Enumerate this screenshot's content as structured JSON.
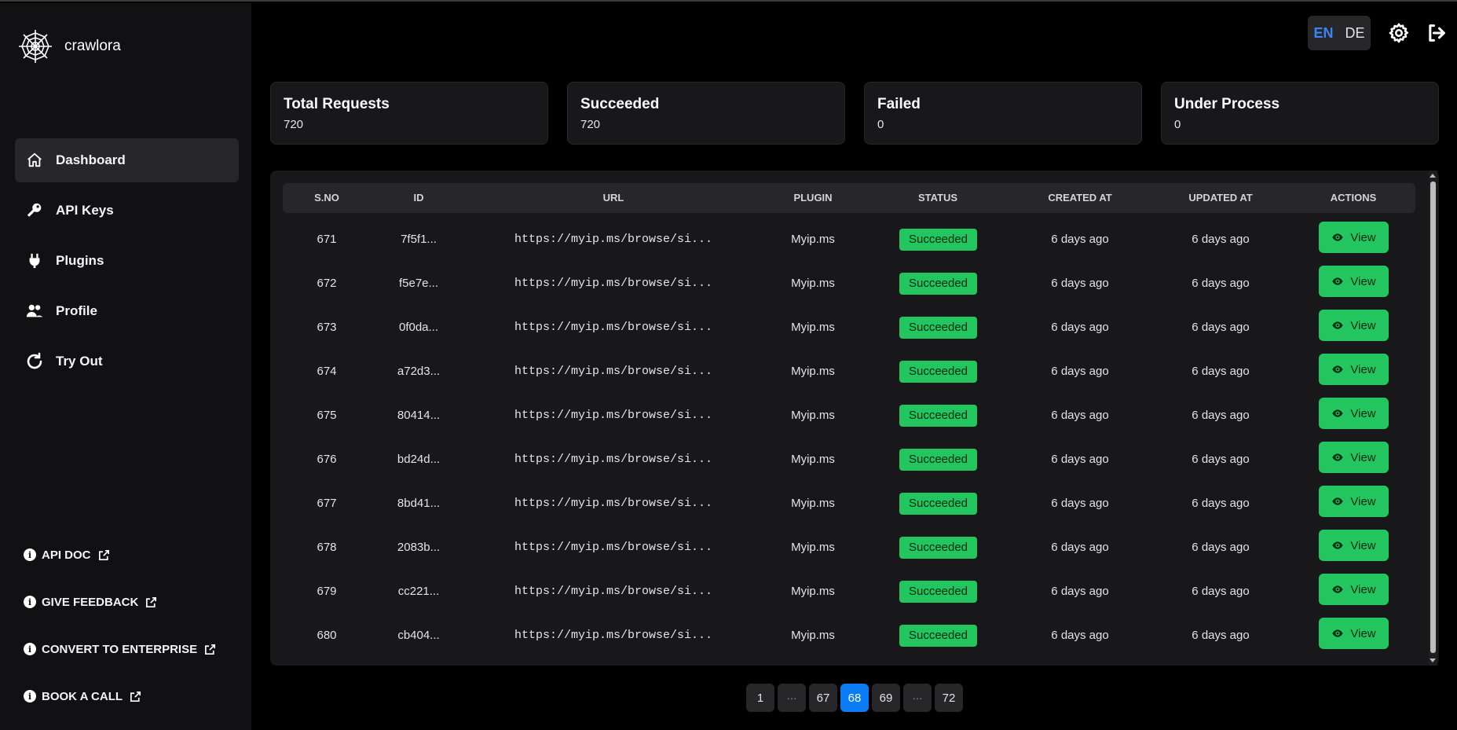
{
  "app": {
    "name": "crawlora"
  },
  "sidebar": {
    "items": [
      {
        "label": "Dashboard",
        "icon": "home-icon"
      },
      {
        "label": "API Keys",
        "icon": "key-icon"
      },
      {
        "label": "Plugins",
        "icon": "plug-icon"
      },
      {
        "label": "Profile",
        "icon": "users-icon"
      },
      {
        "label": "Try Out",
        "icon": "refresh-icon"
      }
    ],
    "active": "Dashboard",
    "links": [
      {
        "label": "API DOC"
      },
      {
        "label": "GIVE FEEDBACK"
      },
      {
        "label": "CONVERT TO ENTERPRISE"
      },
      {
        "label": "BOOK A CALL"
      }
    ]
  },
  "topbar": {
    "lang_en": "EN",
    "lang_de": "DE",
    "active_lang": "EN"
  },
  "stats": [
    {
      "title": "Total Requests",
      "value": "720"
    },
    {
      "title": "Succeeded",
      "value": "720"
    },
    {
      "title": "Failed",
      "value": "0"
    },
    {
      "title": "Under Process",
      "value": "0"
    }
  ],
  "table": {
    "headers": [
      "S.NO",
      "ID",
      "URL",
      "PLUGIN",
      "STATUS",
      "CREATED AT",
      "UPDATED AT",
      "ACTIONS"
    ],
    "rows": [
      {
        "sno": "671",
        "id": "7f5f1...",
        "url": "https://myip.ms/browse/si...",
        "plugin": "Myip.ms",
        "status": "Succeeded",
        "created": "6 days ago",
        "updated": "6 days ago",
        "action": "View"
      },
      {
        "sno": "672",
        "id": "f5e7e...",
        "url": "https://myip.ms/browse/si...",
        "plugin": "Myip.ms",
        "status": "Succeeded",
        "created": "6 days ago",
        "updated": "6 days ago",
        "action": "View"
      },
      {
        "sno": "673",
        "id": "0f0da...",
        "url": "https://myip.ms/browse/si...",
        "plugin": "Myip.ms",
        "status": "Succeeded",
        "created": "6 days ago",
        "updated": "6 days ago",
        "action": "View"
      },
      {
        "sno": "674",
        "id": "a72d3...",
        "url": "https://myip.ms/browse/si...",
        "plugin": "Myip.ms",
        "status": "Succeeded",
        "created": "6 days ago",
        "updated": "6 days ago",
        "action": "View"
      },
      {
        "sno": "675",
        "id": "80414...",
        "url": "https://myip.ms/browse/si...",
        "plugin": "Myip.ms",
        "status": "Succeeded",
        "created": "6 days ago",
        "updated": "6 days ago",
        "action": "View"
      },
      {
        "sno": "676",
        "id": "bd24d...",
        "url": "https://myip.ms/browse/si...",
        "plugin": "Myip.ms",
        "status": "Succeeded",
        "created": "6 days ago",
        "updated": "6 days ago",
        "action": "View"
      },
      {
        "sno": "677",
        "id": "8bd41...",
        "url": "https://myip.ms/browse/si...",
        "plugin": "Myip.ms",
        "status": "Succeeded",
        "created": "6 days ago",
        "updated": "6 days ago",
        "action": "View"
      },
      {
        "sno": "678",
        "id": "2083b...",
        "url": "https://myip.ms/browse/si...",
        "plugin": "Myip.ms",
        "status": "Succeeded",
        "created": "6 days ago",
        "updated": "6 days ago",
        "action": "View"
      },
      {
        "sno": "679",
        "id": "cc221...",
        "url": "https://myip.ms/browse/si...",
        "plugin": "Myip.ms",
        "status": "Succeeded",
        "created": "6 days ago",
        "updated": "6 days ago",
        "action": "View"
      },
      {
        "sno": "680",
        "id": "cb404...",
        "url": "https://myip.ms/browse/si...",
        "plugin": "Myip.ms",
        "status": "Succeeded",
        "created": "6 days ago",
        "updated": "6 days ago",
        "action": "View"
      }
    ]
  },
  "pagination": {
    "pages": [
      "1",
      "···",
      "67",
      "68",
      "69",
      "···",
      "72"
    ],
    "current": "68"
  },
  "colors": {
    "accent": "#22c55e",
    "active_page": "#0a7cf5",
    "lang_active": "#3b82f6"
  }
}
